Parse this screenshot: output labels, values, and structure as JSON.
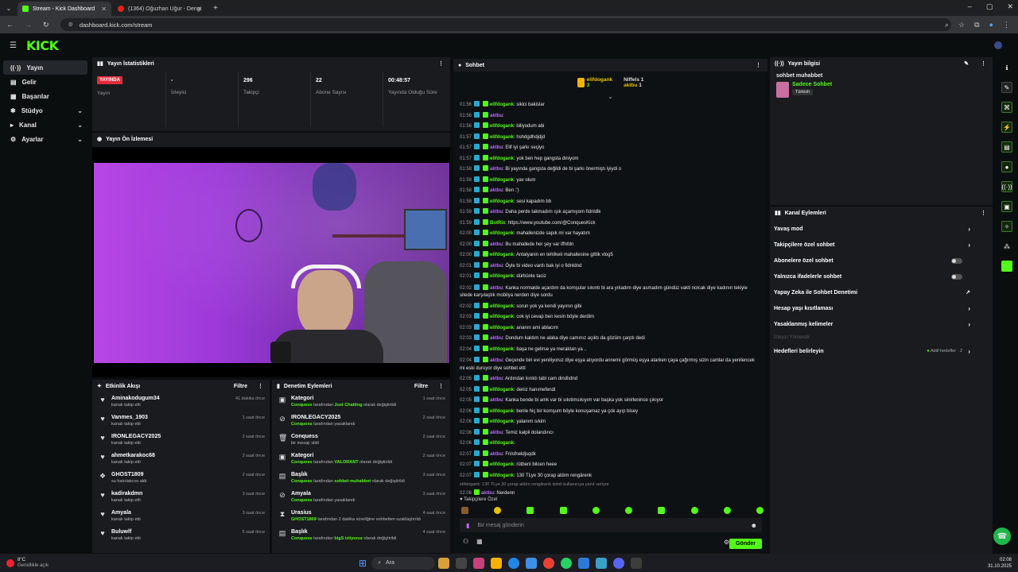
{
  "browser": {
    "tabs": [
      {
        "label": "Stream - Kick Dashboard"
      },
      {
        "label": "(1364) Oğuzhan Uğur - Dengi"
      }
    ],
    "url": "dashboard.kick.com/stream"
  },
  "nav": {
    "logo": "KICK",
    "items": [
      {
        "label": "Yayın"
      },
      {
        "label": "Gelir"
      },
      {
        "label": "Başarılar"
      },
      {
        "label": "Stüdyo"
      },
      {
        "label": "Kanal"
      },
      {
        "label": "Ayarlar"
      }
    ]
  },
  "stats": {
    "title": "Yayın İstatistikleri",
    "live_badge": "YAYINDA",
    "items": [
      {
        "label": "Yayın",
        "value": ""
      },
      {
        "label": "İzleyici",
        "value": "-"
      },
      {
        "label": "Takipçi",
        "value": "296"
      },
      {
        "label": "Abone Sayısı",
        "value": "22"
      },
      {
        "label": "Yayında Olduğu Süre",
        "value": "00:48:57"
      }
    ]
  },
  "preview": {
    "title": "Yayın Ön İzlemesi"
  },
  "activity": {
    "title": "Etkinlik Akışı",
    "filter": "Filtre",
    "rows": [
      {
        "name": "Aminakodugum34",
        "sub": "kanalı takip etti",
        "time": "41 dakika önce"
      },
      {
        "name": "Vanmes_1903",
        "sub": "kanalı takip etti",
        "time": "1 saat önce"
      },
      {
        "name": "IRONLEGACY2025",
        "sub": "kanalı takip etti",
        "time": "2 saat önce"
      },
      {
        "name": "ahmetkarakoc68",
        "sub": "kanalı takip etti",
        "time": "2 saat önce"
      },
      {
        "name": "GHOST1809",
        "sub": "su hatırlatıcısı aldı",
        "time": "2 saat önce"
      },
      {
        "name": "kadirakdmn",
        "sub": "kanalı takip etti",
        "time": "3 saat önce"
      },
      {
        "name": "Amyala",
        "sub": "kanalı takip etti",
        "time": "3 saat önce"
      },
      {
        "name": "Buluwlf",
        "sub": "kanalı takip etti",
        "time": "5 saat önce"
      }
    ]
  },
  "moderation": {
    "title": "Denetim Eylemleri",
    "filter": "Filtre",
    "rows": [
      {
        "name": "Kategori",
        "pre": "Conquess",
        "mid": " tarafından ",
        "hl": "Just Chatting",
        "post": " olarak değiştirildi",
        "time": "1 saat önce"
      },
      {
        "name": "IRONLEGACY2025",
        "pre": "Conquess",
        "mid": " tarafından yasaklandı",
        "hl": "",
        "post": "",
        "time": "2 saat önce"
      },
      {
        "name": "Conquess",
        "pre": "",
        "mid": "bir mesajı sildi",
        "hl": "",
        "post": "",
        "time": "2 saat önce"
      },
      {
        "name": "Kategori",
        "pre": "Conquess",
        "mid": " tarafından ",
        "hl": "VALORANT",
        "post": " olarak değiştirildi",
        "time": "2 saat önce"
      },
      {
        "name": "Başlık",
        "pre": "Conquess",
        "mid": " tarafından ",
        "hl": "sohbet muhabbet",
        "post": " olarak değiştirildi",
        "time": "3 saat önce"
      },
      {
        "name": "Amyala",
        "pre": "Conquess",
        "mid": " tarafından yasaklandı",
        "hl": "",
        "post": "",
        "time": "3 saat önce"
      },
      {
        "name": "Urasius",
        "pre": "GHOST1809",
        "mid": " tarafından 2 dakika süreliğine sohbetten uzaklaştırıldı",
        "hl": "",
        "post": "",
        "time": "4 saat önce"
      },
      {
        "name": "Başlık",
        "pre": "Conquess",
        "mid": " tarafından ",
        "hl": "bigS izliyoruz",
        "post": " olarak değiştirildi",
        "time": "4 saat önce"
      }
    ]
  },
  "chat": {
    "title": "Sohbet",
    "top": [
      {
        "name": "elifdogank",
        "count": "3"
      },
      {
        "name": "Niffels",
        "count": "1"
      },
      {
        "name": "aktbu",
        "count": "1"
      }
    ],
    "messages": [
      {
        "t": "01:56",
        "u": "elifdogank",
        "c": "u1",
        "m": "sikici bakislar"
      },
      {
        "t": "01:56",
        "u": "aktbu",
        "c": "u2",
        "m": ""
      },
      {
        "t": "01:56",
        "u": "elifdogank",
        "c": "u1",
        "m": "biliyodum abi"
      },
      {
        "t": "01:57",
        "u": "elifdogank",
        "c": "u1",
        "m": "hshdgdhdjdjd"
      },
      {
        "t": "01:57",
        "u": "aktbu",
        "c": "u2",
        "m": "Elif iyi şarkı seçiyo"
      },
      {
        "t": "01:57",
        "u": "elifdogank",
        "c": "u1",
        "m": "yok ben hep gangsta diniyom"
      },
      {
        "t": "01:58",
        "u": "aktbu",
        "c": "u2",
        "m": "Bi yayında gangsta değildi de bi şarkı önermiştı iyiydi o"
      },
      {
        "t": "01:58",
        "u": "elifdogank",
        "c": "u1",
        "m": "yav olum"
      },
      {
        "t": "01:58",
        "u": "aktbu",
        "c": "u2",
        "m": "Ben :')"
      },
      {
        "t": "01:58",
        "u": "elifdogank",
        "c": "u1",
        "m": "sesi kapadım bb"
      },
      {
        "t": "01:59",
        "u": "aktbu",
        "c": "u2",
        "m": "Daha perde takmadım ışık açamıyom fidnldlk"
      },
      {
        "t": "01:59",
        "u": "BotRix",
        "c": "u1",
        "m": "https://www.youtube.com/@ConquesKick"
      },
      {
        "t": "02:00",
        "u": "elifdogank",
        "c": "u1",
        "m": "mahallenizde sapık mi var hayatım"
      },
      {
        "t": "02:00",
        "u": "aktbu",
        "c": "u2",
        "m": "Bu mahallede her şey var iffnfdn"
      },
      {
        "t": "02:00",
        "u": "elifdogank",
        "c": "u1",
        "m": "Antalyanin en tehlikeli mahallesine gittik vlog5"
      },
      {
        "t": "02:01",
        "u": "aktbu",
        "c": "u2",
        "m": "Öyle bi video vardı bak iyi o fidnldnd"
      },
      {
        "t": "02:01",
        "u": "elifdogank",
        "c": "u1",
        "m": "dürbünle taciz"
      },
      {
        "t": "02:02",
        "u": "aktbu",
        "c": "u2",
        "m": "Kanka normalde açardım da komşular sıkıntı bi ara yıkadım diye asmadım gündüz vakti nolcak diye kadının tekiyle sitede karşılaştık mobilya nerden diye sordu",
        "wrap": true
      },
      {
        "t": "02:02",
        "u": "elifdogank",
        "c": "u1",
        "m": "sorun yok ya kendi yayının gibi"
      },
      {
        "t": "02:03",
        "u": "elifdogank",
        "c": "u1",
        "m": "cok iyi cevap ben kesin böyle derdim"
      },
      {
        "t": "02:03",
        "u": "elifdogank",
        "c": "u1",
        "m": "ananın ami ablacım"
      },
      {
        "t": "02:03",
        "u": "aktbu",
        "c": "u2",
        "m": "Dondum kaldım ne alaka diye camınız açıktı da gözüm çarptı dedi"
      },
      {
        "t": "02:04",
        "u": "elifdogank",
        "c": "u1",
        "m": "başa ne gelirse ya meraktan ya .."
      },
      {
        "t": "02:04",
        "u": "aktbu",
        "c": "u2",
        "m": "Geçende biri evi yeniliyoruz diye eşya atıyordu annemi görmüş eşya atarken çaya çağırmış sizin camlar da yenilencek mi eski duruyor diye sohbet etti",
        "wrap": true
      },
      {
        "t": "02:05",
        "u": "aktbu",
        "c": "u2",
        "m": "Ardından kırıktı tabi cam dindlıdnd"
      },
      {
        "t": "02:05",
        "u": "elifdogank",
        "c": "u1",
        "m": "deniz hanımefendi"
      },
      {
        "t": "02:05",
        "u": "aktbu",
        "c": "u2",
        "m": "Kanka bende bi amk var bi sıkıtimsıkıyım var başka yok sinirlenince çıkıyor"
      },
      {
        "t": "02:06",
        "u": "elifdogank",
        "c": "u1",
        "m": "benle hiç bir komşum böyle konuşamaz ya çok ayıp bisey"
      },
      {
        "t": "02:06",
        "u": "elifdogank",
        "c": "u1",
        "m": "yalanım sıkim"
      },
      {
        "t": "02:06",
        "u": "aktbu",
        "c": "u2",
        "m": "Temiz kalpli dolandırıcı"
      },
      {
        "t": "02:06",
        "u": "elifdogank",
        "c": "u1",
        "m": ""
      },
      {
        "t": "02:07",
        "u": "aktbu",
        "c": "u2",
        "m": "Fnlsfneldjsqdk"
      },
      {
        "t": "02:07",
        "u": "elifdogank",
        "c": "u1",
        "m": "rütbeni bilcen heee"
      },
      {
        "t": "02:07",
        "u": "elifdogank",
        "c": "u1",
        "m": "130 TLye 30 çorap aldım rengârenk"
      }
    ],
    "notice": "elifdogank: 130 TLye 30 çorap aldım rengârenk isimli kullanıcıya yanıt veriyor",
    "last": {
      "t": "02:08",
      "u": "aktbu",
      "m": "Nerdenn"
    },
    "followers_only": "Takipçilere Özel",
    "placeholder": "Bir mesaj gönderin",
    "send": "Gönder"
  },
  "stream_info": {
    "title": "Yayın bilgisi",
    "stream_title": "sohbet muhabbet",
    "category": "Sadece Sohbet",
    "tag": "Türkish"
  },
  "channel_actions": {
    "title": "Kanal Eylemleri",
    "items": [
      {
        "label": "Yavaş mod",
        "kind": "arrow"
      },
      {
        "label": "Takipçilere özel sohbet",
        "kind": "arrow"
      },
      {
        "label": "Abonelere özel sohbet",
        "kind": "toggle"
      },
      {
        "label": "Yalnızca ifadelerle sohbet",
        "kind": "toggle"
      },
      {
        "label": "Yapay Zeka ile Sohbet Denetimi",
        "kind": "ext"
      },
      {
        "label": "Hesap yaşı kısıtlaması",
        "kind": "arrow"
      },
      {
        "label": "Yasaklanmış kelimeler",
        "kind": "arrow"
      }
    ],
    "disabled": "İzleyici Yönlendir",
    "goals": "Hedefleri belirleyin",
    "goals_status": "Aktif hedefler · 2"
  },
  "taskbar": {
    "weather": "8°C",
    "weather_sub": "Genellikle açık",
    "search": "Ara",
    "time": "02:08",
    "date": "31.10.2025"
  }
}
